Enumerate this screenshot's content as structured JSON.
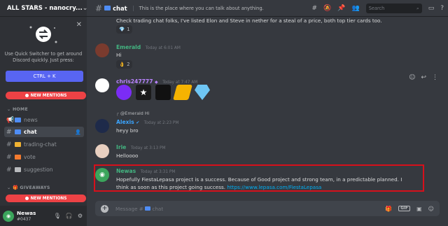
{
  "server": {
    "name": "ALL STARS - nanocry..."
  },
  "quick_switcher": {
    "text": "Use Quick Switcher to get around Discord quickly. Just press:",
    "shortcut": "CTRL + K"
  },
  "mentions": {
    "top_label": "NEW MENTIONS",
    "bottom_label": "NEW MENTIONS"
  },
  "categories": {
    "home": "HOME",
    "giveaways": "GIVEAWAYS"
  },
  "channels": [
    {
      "name": "news"
    },
    {
      "name": "chat"
    },
    {
      "name": "trading-chat"
    },
    {
      "name": "vote"
    },
    {
      "name": "suggestion"
    }
  ],
  "user": {
    "name": "Newas",
    "tag": "#0437"
  },
  "topbar": {
    "channel": "chat",
    "topic": "This is the place where you can talk about anything.",
    "search_placeholder": "Search"
  },
  "messages": [
    {
      "author": "",
      "time": "",
      "text": "Check trading chat folks, I've listed Elon and Steve in nether for a steal of a price, both top tier cards too.",
      "reaction": {
        "count": "1"
      }
    },
    {
      "author": "Emerald",
      "time": "Today at 6:01 AM",
      "text": "Hi",
      "reaction": {
        "count": "2"
      }
    },
    {
      "author": "chris247777",
      "time": "Today at 7:47 AM"
    },
    {
      "reply_author": "@Emerald",
      "reply_text": "Hi",
      "author": "Alexis",
      "time": "Today at 2:23 PM",
      "text": "heyy bro"
    },
    {
      "author": "Irie",
      "time": "Today at 3:13 PM",
      "text": "Helloooo"
    },
    {
      "author": "Newas",
      "time": "Today at 3:31 PM",
      "text": "Hopefully FiestaLepasa project is a success. Because of Good project and strong team, in a predictable planned. I think as soon as this project going success.",
      "link": "https://www.lepasa.com/FiestaLepasa"
    }
  ],
  "composer": {
    "placeholder_prefix": "Message #",
    "placeholder_channel": "chat"
  },
  "colors": {
    "accent": "#5865f2",
    "mention": "#ed4245",
    "highlight_border": "#d7101b",
    "emerald": "#43b581",
    "chris": "#b983ff",
    "alexis": "#3ba5ff",
    "newas": "#3ba55c"
  }
}
